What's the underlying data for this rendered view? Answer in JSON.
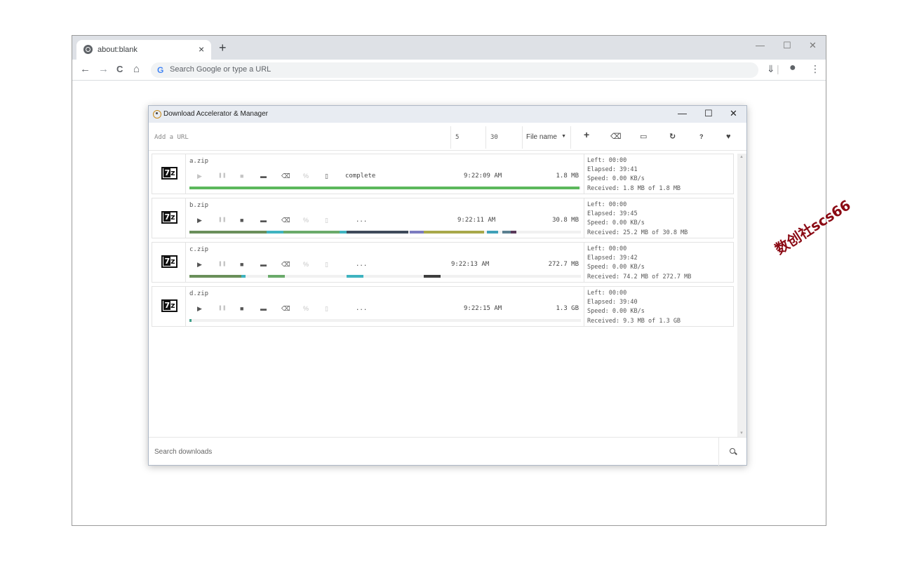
{
  "browser": {
    "tab_title": "about:blank",
    "tab_close": "×",
    "new_tab": "+",
    "window_controls": {
      "minimize": "—",
      "maximize": "☐",
      "close": "✕"
    },
    "nav": {
      "back": "←",
      "forward": "→",
      "reload": "C",
      "home": "⌂"
    },
    "omnibox_placeholder": "Search Google or type a URL",
    "google_letter": "G",
    "download_icon": "⇓",
    "profile_icon": "●",
    "menu_icon": "⋮"
  },
  "app": {
    "title": "Download Accelerator & Manager",
    "controls": {
      "minimize": "—",
      "maximize": "☐",
      "close": "✕"
    },
    "toolbar": {
      "url_placeholder": "Add a URL",
      "threads": "5",
      "timeout": "30",
      "sort_label": "File name",
      "sort_caret": "▼",
      "icons": {
        "add": "+",
        "clear": "⌫",
        "folder": "▭",
        "refresh": "↻",
        "help": "?",
        "heart": "♥"
      }
    },
    "search_placeholder": "Search downloads",
    "downloads": [
      {
        "filename": "a.zip",
        "status": "complete",
        "time": "9:22:09 AM",
        "size": "1.8 MB",
        "left": "Left: 00:00",
        "elapsed": "Elapsed: 39:41",
        "speed": "Speed: 0.00 KB/s",
        "received": "Received: 1.8 MB of 1.8 MB",
        "active": false
      },
      {
        "filename": "b.zip",
        "status": "...",
        "time": "9:22:11 AM",
        "size": "30.8 MB",
        "left": "Left: 00:00",
        "elapsed": "Elapsed: 39:45",
        "speed": "Speed: 0.00 KB/s",
        "received": "Received: 25.2 MB of 30.8 MB",
        "active": true
      },
      {
        "filename": "c.zip",
        "status": "...",
        "time": "9:22:13 AM",
        "size": "272.7 MB",
        "left": "Left: 00:00",
        "elapsed": "Elapsed: 39:42",
        "speed": "Speed: 0.00 KB/s",
        "received": "Received: 74.2 MB of 272.7 MB",
        "active": true
      },
      {
        "filename": "d.zip",
        "status": "...",
        "time": "9:22:15 AM",
        "size": "1.3 GB",
        "left": "Left: 00:00",
        "elapsed": "Elapsed: 39:40",
        "speed": "Speed: 0.00 KB/s",
        "received": "Received: 9.3 MB of 1.3 GB",
        "active": true
      }
    ],
    "row_controls": {
      "play": "▶",
      "pause": "❚❚",
      "stop": "■",
      "folder": "▬",
      "erase": "⌫",
      "link": "%",
      "trash": "▯"
    },
    "colors": {
      "complete": "#5cb85c",
      "segment_green": "#6a8f5a",
      "segment_teal": "#3fb3c0",
      "segment_dark": "#3e4a5a",
      "segment_olive": "#a8a84a",
      "segment_purple": "#7c7cc0"
    }
  },
  "watermark": "数创社scs66"
}
